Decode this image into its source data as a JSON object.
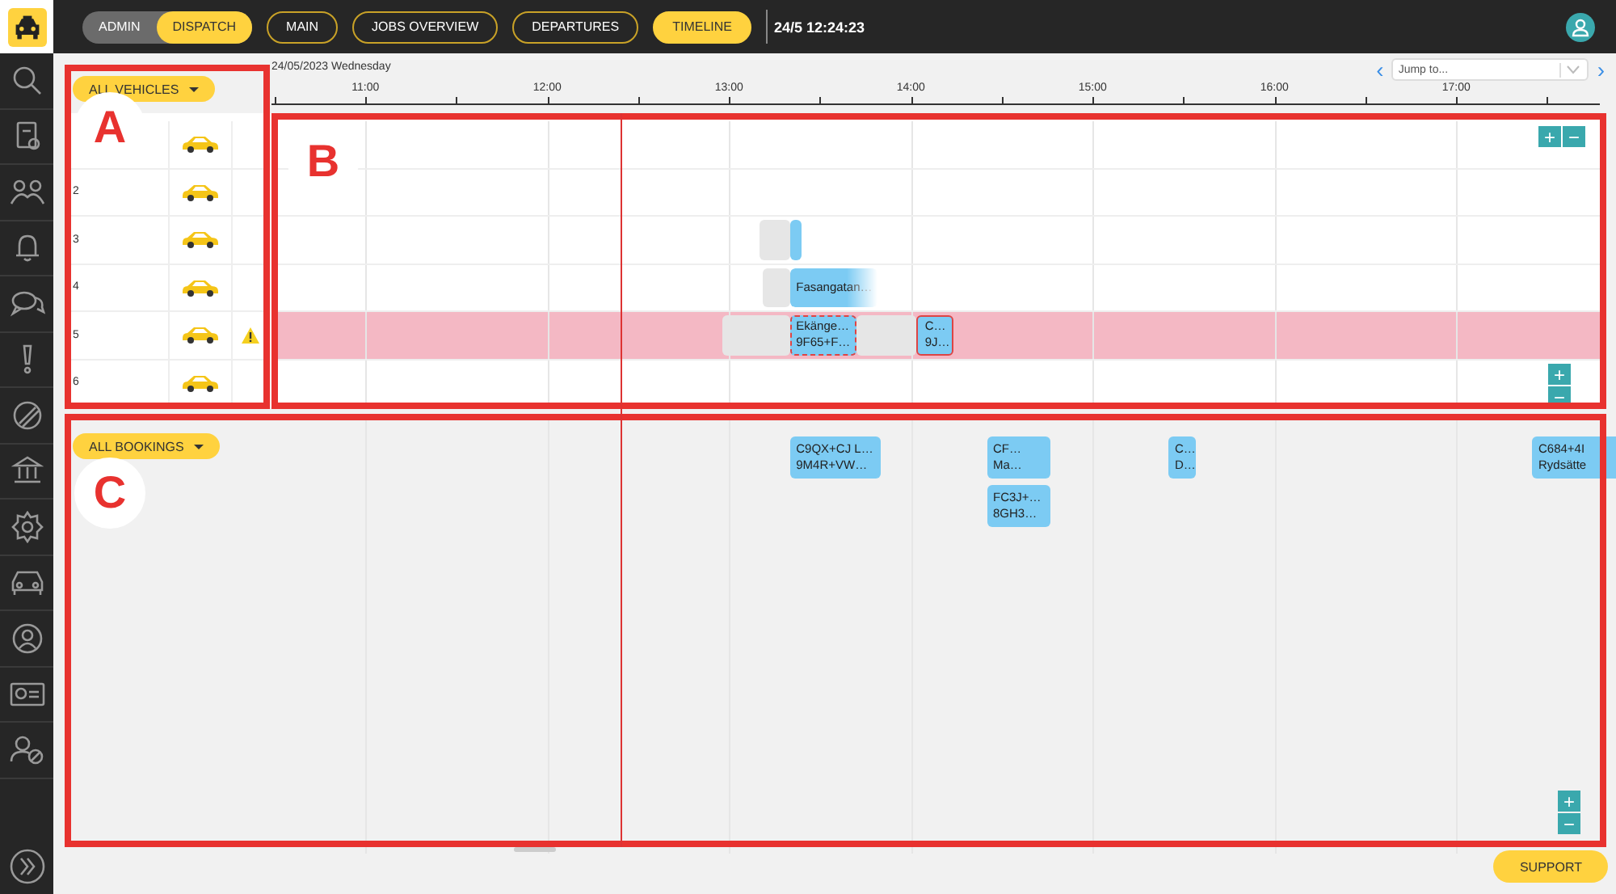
{
  "sidebar": {
    "items": [
      {
        "kind": "search"
      },
      {
        "kind": "document"
      },
      {
        "kind": "handshake"
      },
      {
        "kind": "bell"
      },
      {
        "kind": "chat"
      },
      {
        "kind": "alert"
      },
      {
        "kind": "blocked"
      },
      {
        "kind": "bank"
      },
      {
        "kind": "settings"
      },
      {
        "kind": "car"
      },
      {
        "kind": "user"
      },
      {
        "kind": "idcard"
      },
      {
        "kind": "userblocked"
      }
    ]
  },
  "mode_toggle": [
    {
      "label": "ADMIN",
      "selected": false
    },
    {
      "label": "DISPATCH",
      "selected": true
    }
  ],
  "nav": [
    {
      "label": "MAIN",
      "selected": false
    },
    {
      "label": "JOBS OVERVIEW",
      "selected": false
    },
    {
      "label": "DEPARTURES",
      "selected": false
    },
    {
      "label": "TIMELINE",
      "selected": true
    }
  ],
  "clock": "24/5 12:24:23",
  "date": "24/05/2023 Wednesday",
  "jump": {
    "placeholder": "Jump to...",
    "prev": "‹",
    "next": "›"
  },
  "hours": [
    "11:00",
    "12:00",
    "13:00",
    "14:00",
    "15:00",
    "16:00",
    "17:00"
  ],
  "vehicles": {
    "filter": "ALL VEHICLES",
    "zoom": {
      "in": "+",
      "out": "−"
    },
    "rows": [
      {
        "highlighted": false,
        "warning": false,
        "items": []
      },
      {
        "number": "2",
        "highlighted": false,
        "warning": false,
        "items": []
      },
      {
        "number": "3",
        "highlighted": false,
        "warning": false,
        "items": [
          {
            "kind": "wait",
            "faded": false,
            "dashed": false,
            "alert": false
          },
          {
            "kind": "trip",
            "faded": false,
            "dashed": false,
            "alert": false
          }
        ]
      },
      {
        "number": "4",
        "highlighted": false,
        "warning": false,
        "items": [
          {
            "kind": "wait",
            "faded": false,
            "dashed": false,
            "alert": false
          },
          {
            "kind": "trip",
            "faded": true,
            "dashed": false,
            "alert": false,
            "lines": [
              "Fasangatan…"
            ]
          }
        ]
      },
      {
        "number": "5",
        "highlighted": true,
        "warning": true,
        "items": [
          {
            "kind": "wait",
            "faded": false,
            "dashed": false,
            "alert": false
          },
          {
            "kind": "trip",
            "faded": false,
            "dashed": true,
            "alert": false,
            "lines": [
              "Ekänge…",
              "9F65+F…"
            ]
          },
          {
            "kind": "wait",
            "faded": false,
            "dashed": false,
            "alert": false
          },
          {
            "kind": "trip",
            "faded": false,
            "dashed": false,
            "alert": true,
            "lines": [
              "C…",
              "9J…"
            ]
          }
        ]
      },
      {
        "number": "6",
        "highlighted": false,
        "warning": false,
        "items": []
      }
    ]
  },
  "vehicles_zoom_bottom": {
    "in": "+",
    "out": "−"
  },
  "bookings": {
    "filter": "ALL BOOKINGS",
    "zoom": {
      "in": "+",
      "out": "−"
    },
    "lanes": [
      {
        "items": [
          {
            "lines": [
              "C9QX+CJ L…",
              "9M4R+VW…"
            ]
          },
          {
            "lines": [
              "CF…",
              "Ma…"
            ]
          },
          {
            "lines": [
              "C…",
              "D…"
            ]
          },
          {
            "lines": [
              "C684+4I",
              "Rydsätte"
            ]
          }
        ]
      },
      {
        "items": [
          {
            "lines": [
              "FC3J+…",
              "8GH3…"
            ]
          }
        ]
      }
    ]
  },
  "annotations": [
    {
      "label": "A"
    },
    {
      "label": "B"
    },
    {
      "label": "C"
    }
  ],
  "support": "SUPPORT"
}
